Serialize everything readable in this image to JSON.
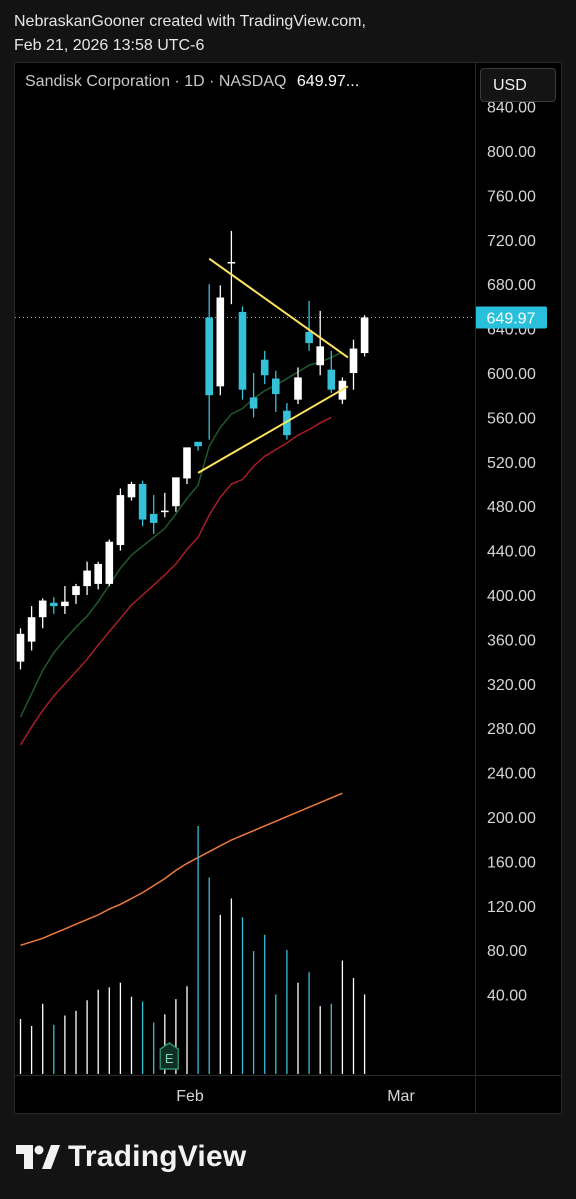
{
  "header": {
    "line1": "NebraskanGooner created with TradingView.com,",
    "line2": "Feb 21, 2026 13:58 UTC-6"
  },
  "legend": {
    "symbol": "Sandisk Corporation · 1D · NASDAQ",
    "last_value": "649.97..."
  },
  "currency_button": "USD",
  "last_price_label": "649.97",
  "footer": {
    "brand": "TradingView",
    "logo_icon": "tradingview-logo-icon"
  },
  "earnings_marker": "E",
  "colors": {
    "up_candle": "#ffffff",
    "down_candle": "#35c1d8",
    "ema_short": "#1e5a2e",
    "ema_long": "#a81e24",
    "volume_ma": "#f07a3c",
    "triangle": "#ffe45c",
    "price_label_bg": "#29c0dc"
  },
  "chart_data": {
    "type": "candlestick",
    "title": "Sandisk Corporation · 1D · NASDAQ",
    "y_ticks": [
      "840.00",
      "800.00",
      "760.00",
      "720.00",
      "680.00",
      "640.00",
      "600.00",
      "560.00",
      "520.00",
      "480.00",
      "440.00",
      "400.00",
      "360.00",
      "320.00",
      "280.00",
      "240.00",
      "200.00",
      "160.00",
      "120.00",
      "80.00",
      "40.00"
    ],
    "x_ticks": [
      "Feb",
      "Mar"
    ],
    "ylim": [
      0,
      880
    ],
    "candles": [
      {
        "o": 340,
        "h": 370,
        "l": 333,
        "c": 365
      },
      {
        "o": 358,
        "h": 390,
        "l": 350,
        "c": 380
      },
      {
        "o": 380,
        "h": 397,
        "l": 370,
        "c": 395
      },
      {
        "o": 393,
        "h": 398,
        "l": 383,
        "c": 390
      },
      {
        "o": 390,
        "h": 408,
        "l": 383,
        "c": 394
      },
      {
        "o": 400,
        "h": 410,
        "l": 392,
        "c": 408
      },
      {
        "o": 408,
        "h": 430,
        "l": 400,
        "c": 422
      },
      {
        "o": 410,
        "h": 430,
        "l": 405,
        "c": 428
      },
      {
        "o": 410,
        "h": 450,
        "l": 408,
        "c": 448
      },
      {
        "o": 445,
        "h": 496,
        "l": 440,
        "c": 490
      },
      {
        "o": 488,
        "h": 502,
        "l": 485,
        "c": 500
      },
      {
        "o": 500,
        "h": 503,
        "l": 462,
        "c": 468
      },
      {
        "o": 473,
        "h": 490,
        "l": 455,
        "c": 465
      },
      {
        "o": 475,
        "h": 492,
        "l": 470,
        "c": 476
      },
      {
        "o": 480,
        "h": 505,
        "l": 475,
        "c": 506
      },
      {
        "o": 505,
        "h": 530,
        "l": 500,
        "c": 533
      },
      {
        "o": 538,
        "h": 538,
        "l": 530,
        "c": 534
      },
      {
        "o": 650,
        "h": 680,
        "l": 540,
        "c": 580
      },
      {
        "o": 588,
        "h": 679,
        "l": 580,
        "c": 668
      },
      {
        "o": 700,
        "h": 728,
        "l": 662,
        "c": 700
      },
      {
        "o": 655,
        "h": 660,
        "l": 576,
        "c": 585
      },
      {
        "o": 578,
        "h": 600,
        "l": 560,
        "c": 568
      },
      {
        "o": 612,
        "h": 620,
        "l": 590,
        "c": 598
      },
      {
        "o": 595,
        "h": 602,
        "l": 565,
        "c": 581
      },
      {
        "o": 566,
        "h": 573,
        "l": 540,
        "c": 544
      },
      {
        "o": 576,
        "h": 605,
        "l": 572,
        "c": 596
      },
      {
        "o": 637,
        "h": 665,
        "l": 620,
        "c": 627
      },
      {
        "o": 607,
        "h": 656,
        "l": 598,
        "c": 624
      },
      {
        "o": 603,
        "h": 620,
        "l": 582,
        "c": 585
      },
      {
        "o": 576,
        "h": 596,
        "l": 572,
        "c": 593
      },
      {
        "o": 600,
        "h": 630,
        "l": 585,
        "c": 622
      },
      {
        "o": 618,
        "h": 652,
        "l": 615,
        "c": 650
      }
    ],
    "ema_short": [
      290,
      311,
      332,
      348,
      360,
      371,
      381,
      394,
      409,
      424,
      436,
      444,
      452,
      460,
      473,
      487,
      499,
      534,
      551,
      563,
      568,
      577,
      584,
      589,
      595,
      601,
      607,
      610,
      614,
      619
    ],
    "ema_long": [
      265,
      281,
      296,
      309,
      320,
      331,
      342,
      355,
      367,
      379,
      391,
      400,
      409,
      418,
      428,
      441,
      452,
      472,
      488,
      500,
      504,
      516,
      525,
      531,
      537,
      544,
      549,
      555,
      560
    ],
    "volume": [
      47,
      41,
      60,
      42,
      50,
      54,
      63,
      72,
      74,
      78,
      66,
      62,
      44,
      51,
      64,
      75,
      212,
      168,
      136,
      150,
      134,
      105,
      119,
      68,
      106,
      78,
      87,
      58,
      60,
      97,
      82,
      68
    ],
    "volume_ma": [
      110,
      113,
      116,
      120,
      124,
      128,
      132,
      136,
      141,
      145,
      150,
      155,
      161,
      167,
      174,
      180,
      185,
      190,
      195,
      200,
      204,
      208,
      212,
      216,
      220,
      224,
      228,
      232,
      236,
      240
    ],
    "triangle": {
      "upper": {
        "from": 703,
        "to": 614
      },
      "lower": {
        "from": 510,
        "to": 588
      }
    }
  }
}
